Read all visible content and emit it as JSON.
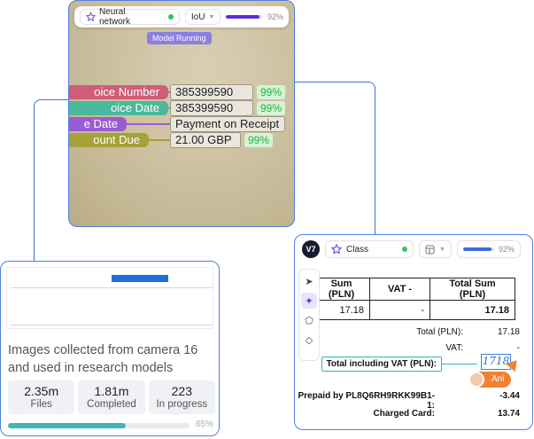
{
  "card1": {
    "toolbar": {
      "class_label": "Neural network",
      "iou_label": "IoU",
      "progress_value": 0.92,
      "progress_text": "92%",
      "accent": "#5a2fd6"
    },
    "status_badge": "Model Running",
    "fields": [
      {
        "label": "oice Number",
        "value": "385399590",
        "confidence": "99%",
        "color": "#cf5d79"
      },
      {
        "label": "oice Date",
        "value": "385399590",
        "confidence": "99%",
        "color": "#4cb89c"
      },
      {
        "label": "e Date",
        "value": "Payment on Receipt",
        "confidence": "",
        "color": "#9a5dd1"
      },
      {
        "label": "ount Due",
        "value": "21.00 GBP",
        "confidence": "99%",
        "color": "#a6a138"
      }
    ]
  },
  "card2": {
    "logo": "V7",
    "toolbar": {
      "class_label": "Class",
      "progress_value": 0.92,
      "progress_text": "92%",
      "accent": "#3b6fd8"
    },
    "tools": [
      "send-icon",
      "ai-assist-icon",
      "polygon-icon",
      "eraser-icon"
    ],
    "table": {
      "headers": [
        "Sum (PLN)",
        "VAT -",
        "Total Sum (PLN)"
      ],
      "row": [
        "17.18",
        "-",
        "17.18"
      ]
    },
    "summary": [
      {
        "label": "Total (PLN):",
        "value": "17.18",
        "bold": false
      },
      {
        "label": "VAT:",
        "value": "-",
        "bold": false
      },
      {
        "label": "Total including VAT (PLN):",
        "value": "1718",
        "bold": true
      },
      {
        "label": "Prepaid by PL8Q6RH9RKK99B1-1:",
        "value": "-3.44",
        "bold": true
      },
      {
        "label": "Charged Card:",
        "value": "13.74",
        "bold": true
      }
    ],
    "annotator": "Ani"
  },
  "card3": {
    "description": "Images collected from camera 16 and used in research models",
    "stats": [
      {
        "value": "2.35m",
        "label": "Files"
      },
      {
        "value": "1.81m",
        "label": "Completed"
      },
      {
        "value": "223",
        "label": "In progress"
      }
    ],
    "progress_value": 0.65,
    "progress_text": "65%"
  }
}
